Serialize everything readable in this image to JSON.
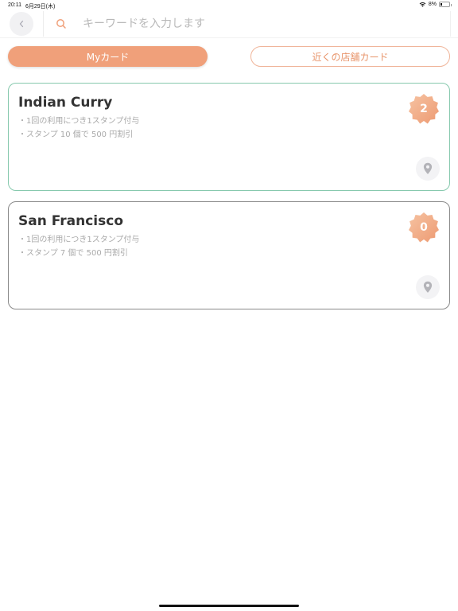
{
  "status_bar": {
    "time": "20:11",
    "date": "6月29日(木)",
    "battery": "8%"
  },
  "search": {
    "placeholder": "キーワードを入力します"
  },
  "tabs": [
    {
      "label": "Myカード",
      "active": true
    },
    {
      "label": "近くの店舗カード",
      "active": false
    }
  ],
  "cards": [
    {
      "title": "Indian Curry",
      "rule_1": "・1回の利用につき1スタンプ付与",
      "rule_2": "・スタンプ 10 個で 500 円割引",
      "stamps": "2"
    },
    {
      "title": "San Francisco",
      "rule_1": "・1回の利用につき1スタンプ付与",
      "rule_2": "・スタンプ 7 個で 500 円割引",
      "stamps": "0"
    }
  ],
  "colors": {
    "accent": "#f0a07a",
    "card_1_border": "#86c9ad",
    "card_2_border": "#8a8a8a"
  }
}
